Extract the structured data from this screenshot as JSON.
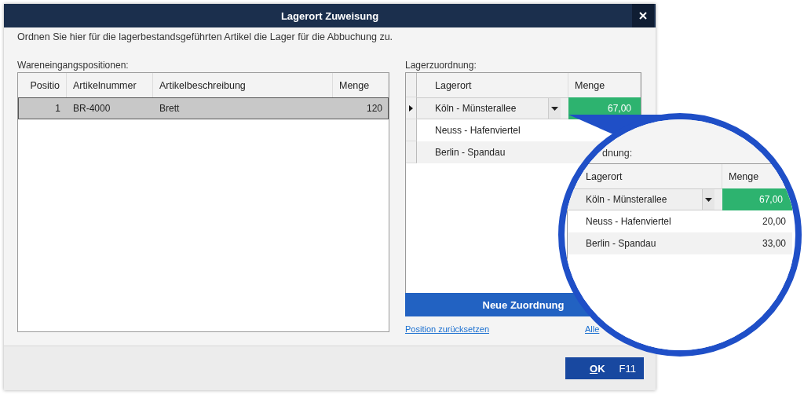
{
  "window": {
    "title": "Lagerort Zuweisung"
  },
  "instruction": "Ordnen Sie hier für die lagerbestandsgeführten Artikel die Lager für die Abbuchung zu.",
  "positions": {
    "label": "Wareneingangspositionen:",
    "columns": [
      "Positio",
      "Artikelnummer",
      "Artikelbeschreibung",
      "Menge"
    ],
    "rows": [
      {
        "cells": [
          "1",
          "BR-4000",
          "Brett",
          "120"
        ],
        "selected": true
      }
    ]
  },
  "assignment": {
    "label": "Lagerzuordnung:",
    "columns": [
      "Lagerort",
      "Menge"
    ],
    "rows": [
      {
        "location": "Köln - Münsterallee",
        "quantity": "67,00",
        "selected": true
      },
      {
        "location": "Neuss - Hafenviertel",
        "selected": false
      },
      {
        "location": "Berlin - Spandau",
        "selected": false
      }
    ],
    "new_button": "Neue Zuordnung",
    "links": [
      "Position zurücksetzen",
      "Alle"
    ]
  },
  "magnifier": {
    "label": "dnung:",
    "columns": [
      "Lagerort",
      "Menge"
    ],
    "rows": [
      {
        "location": "Köln - Münsterallee",
        "quantity": "67,00",
        "selected": true
      },
      {
        "location": "Neuss - Hafenviertel",
        "quantity": "20,00",
        "selected": false
      },
      {
        "location": "Berlin - Spandau",
        "quantity": "33,00",
        "selected": false
      }
    ]
  },
  "footer": {
    "ok": {
      "label": "OK",
      "shortcut": "F11"
    }
  }
}
